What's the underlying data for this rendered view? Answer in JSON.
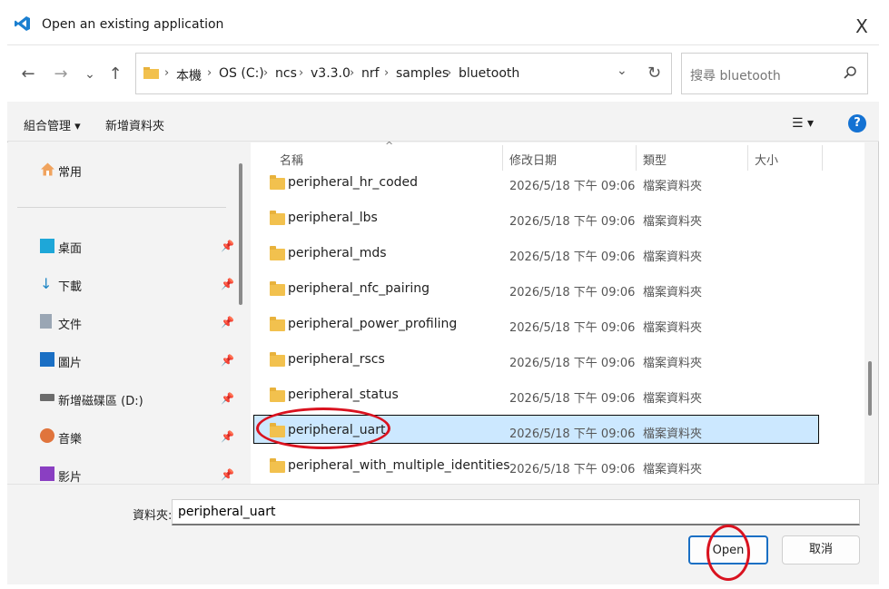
{
  "window": {
    "title": "Open an existing application",
    "close_glyph": "X"
  },
  "nav": {
    "back": "←",
    "forward": "→",
    "history": "⌄",
    "up": "↑",
    "refresh": "↻",
    "addr_dropdown": "⌄"
  },
  "breadcrumb": [
    "本機",
    "OS (C:)",
    "ncs",
    "v3.3.0",
    "nrf",
    "samples",
    "bluetooth"
  ],
  "search": {
    "placeholder": "搜尋 bluetooth"
  },
  "cmdbar": {
    "organize": "組合管理 ▾",
    "new_folder": "新增資料夾",
    "view": "☰ ▾",
    "help": "?"
  },
  "sidebar": {
    "home": "常用",
    "items": [
      {
        "label": "桌面",
        "icon": "desktop-icon"
      },
      {
        "label": "下載",
        "icon": "download-icon"
      },
      {
        "label": "文件",
        "icon": "document-icon"
      },
      {
        "label": "圖片",
        "icon": "pictures-icon"
      },
      {
        "label": "新增磁碟區 (D:)",
        "icon": "drive-icon"
      },
      {
        "label": "音樂",
        "icon": "music-icon"
      },
      {
        "label": "影片",
        "icon": "video-icon"
      }
    ]
  },
  "columns": {
    "name": "名稱",
    "date": "修改日期",
    "type": "類型",
    "size": "大小"
  },
  "rows": [
    {
      "name": "peripheral_hr_coded",
      "date": "2026/5/18 下午 09:06",
      "type": "檔案資料夾"
    },
    {
      "name": "peripheral_lbs",
      "date": "2026/5/18 下午 09:06",
      "type": "檔案資料夾"
    },
    {
      "name": "peripheral_mds",
      "date": "2026/5/18 下午 09:06",
      "type": "檔案資料夾"
    },
    {
      "name": "peripheral_nfc_pairing",
      "date": "2026/5/18 下午 09:06",
      "type": "檔案資料夾"
    },
    {
      "name": "peripheral_power_profiling",
      "date": "2026/5/18 下午 09:06",
      "type": "檔案資料夾"
    },
    {
      "name": "peripheral_rscs",
      "date": "2026/5/18 下午 09:06",
      "type": "檔案資料夾"
    },
    {
      "name": "peripheral_status",
      "date": "2026/5/18 下午 09:06",
      "type": "檔案資料夾"
    },
    {
      "name": "peripheral_uart",
      "date": "2026/5/18 下午 09:06",
      "type": "檔案資料夾"
    },
    {
      "name": "peripheral_with_multiple_identities",
      "date": "2026/5/18 下午 09:06",
      "type": "檔案資料夾"
    }
  ],
  "footer": {
    "folder_label": "資料夾:",
    "folder_value": "peripheral_uart",
    "open": "Open",
    "cancel": "取消"
  },
  "colors": {
    "accent": "#1a6fc4",
    "selection": "#cce8ff",
    "annotation": "#d9121f"
  }
}
